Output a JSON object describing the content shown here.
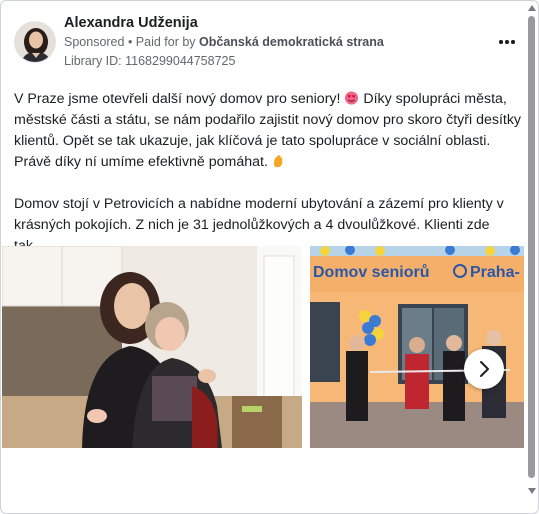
{
  "author": {
    "name": "Alexandra Udženija",
    "sponsored_label": "Sponsored",
    "paid_prefix": " • Paid for by ",
    "payer": "Občanská demokratická strana",
    "library_id": "Library ID: 1168299044758725"
  },
  "post": {
    "paragraph1_a": "V Praze jsme otevřeli další nový domov pro seniory! ",
    "paragraph1_b": " Díky spolupráci města, městské části a státu, se nám podařilo zajistit nový domov pro skoro čtyři desítky klientů. Opět se tak ukazuje, jak klíčová je tato spolupráce v sociální oblasti. Právě díky ní umíme efektivně pomáhat.",
    "paragraph2": "Domov stojí v Petrovicích a nabídne moderní ubytování a zázemí pro klienty v krásných pokojích. Z nich je 31 jednolůžkových a 4 dvoulůžkové. Klienti zde tak..."
  },
  "carousel": {
    "sign_text": "Domov seniorů ",
    "sign_text_2": "Praha-",
    "icons": [
      "smiling-face-with-heart-eyes-icon",
      "waving-hand-icon",
      "chevron-right-icon",
      "more-options-icon"
    ]
  },
  "colors": {
    "accent_text": "#1c1e21",
    "secondary_text": "#65676b",
    "building_orange": "#f2a64f",
    "sign_blue": "#2b57a6"
  }
}
